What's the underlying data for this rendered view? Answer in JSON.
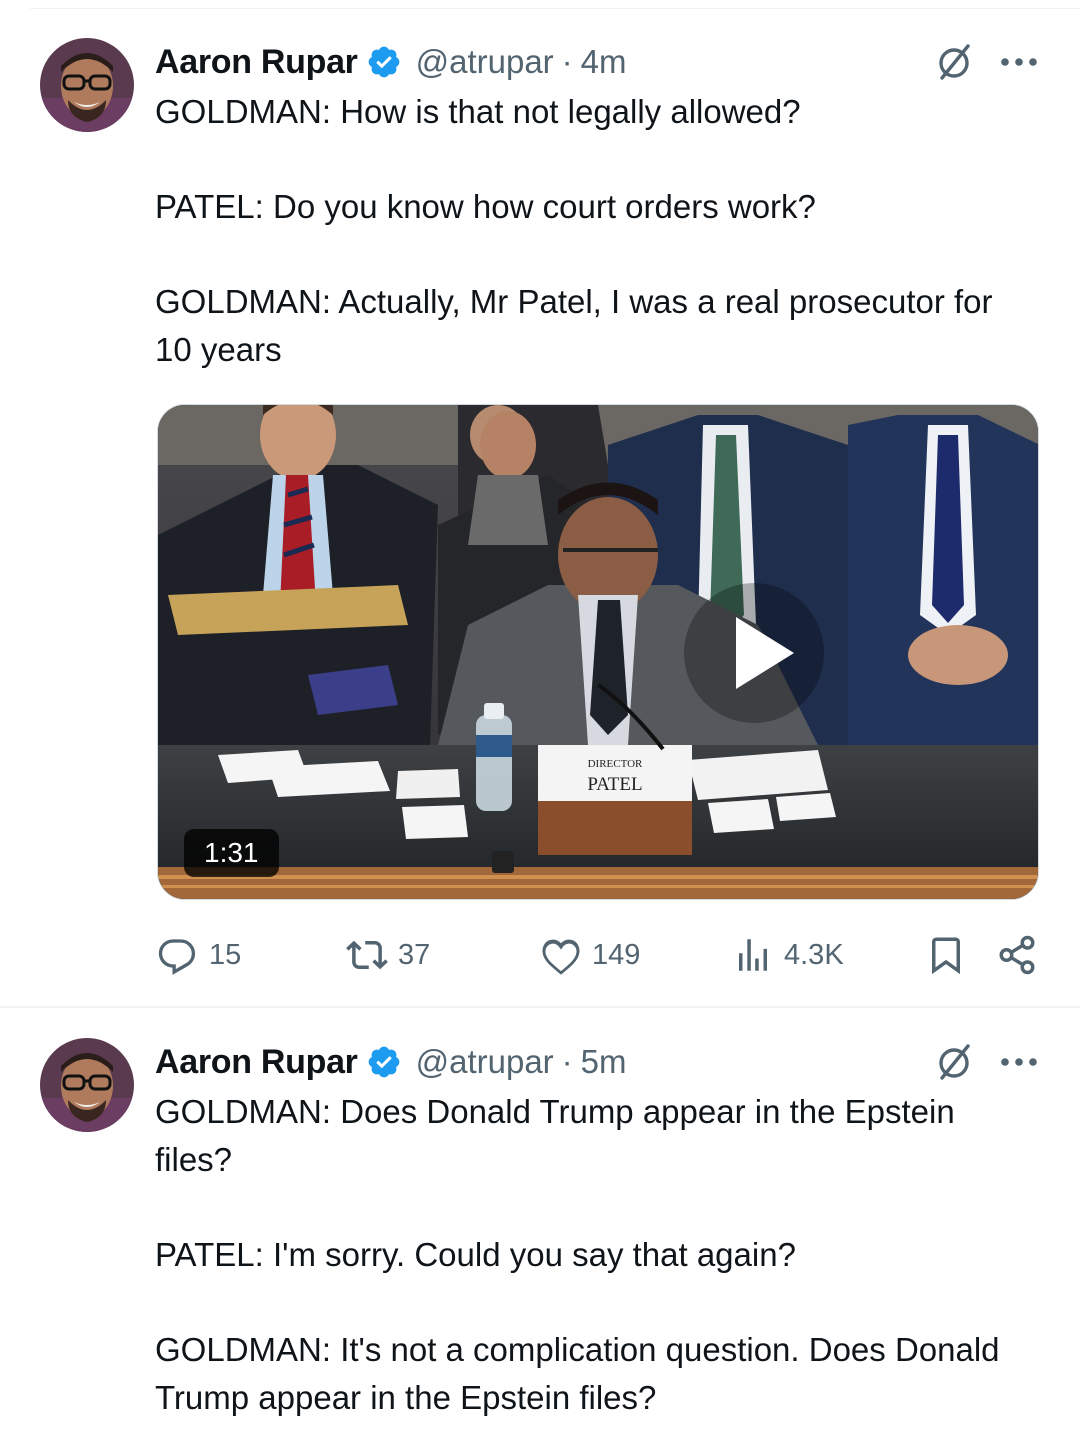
{
  "tweets": [
    {
      "author": {
        "name": "Aaron Rupar",
        "handle": "@atrupar",
        "verified": true
      },
      "separator": "·",
      "time": "4m",
      "text": [
        "GOLDMAN: How is that not legally allowed?",
        "PATEL: Do you know how court orders work?",
        "GOLDMAN: Actually, Mr Patel, I was a real prosecutor for 10 years"
      ],
      "media": {
        "type": "video",
        "duration": "1:31",
        "nameplate": {
          "line1": "DIRECTOR",
          "line2": "PATEL"
        },
        "icons": [
          "play-icon"
        ]
      },
      "actions": {
        "replies": "15",
        "reposts": "37",
        "likes": "149",
        "views": "4.3K"
      },
      "icons": [
        "verified-badge-icon",
        "grok-icon",
        "more-icon",
        "reply-icon",
        "retweet-icon",
        "like-icon",
        "views-icon",
        "bookmark-icon",
        "share-icon"
      ]
    },
    {
      "author": {
        "name": "Aaron Rupar",
        "handle": "@atrupar",
        "verified": true
      },
      "separator": "·",
      "time": "5m",
      "text": [
        "GOLDMAN: Does Donald Trump appear in the Epstein files?",
        "PATEL: I'm sorry. Could you say that again?",
        "GOLDMAN: It's not a complication question. Does Donald Trump appear in the Epstein files?"
      ]
    }
  ],
  "colors": {
    "text": "#0f1419",
    "secondary": "#536471",
    "verified": "#1d9bf0",
    "divider": "#eff3f4"
  }
}
